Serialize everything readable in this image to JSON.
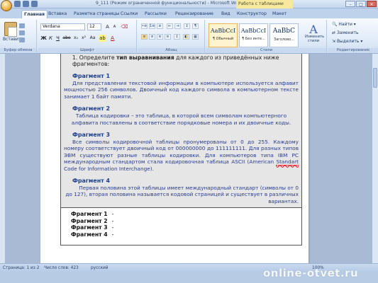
{
  "window": {
    "title": "9_111 (Режим ограниченной функциональности) - Microsoft Word",
    "context_tab": "Работа с таблицами",
    "buttons": [
      "–",
      "□",
      "✕"
    ]
  },
  "tabs": [
    "Главная",
    "Вставка",
    "Разметка страницы",
    "Ссылки",
    "Рассылки",
    "Рецензирование",
    "Вид",
    "Конструктор",
    "Макет"
  ],
  "ribbon": {
    "clipboard": {
      "paste_label": "Вставить",
      "group_label": "Буфер обмена"
    },
    "font": {
      "name": "Verdana",
      "size": "12",
      "group_label": "Шрифт"
    },
    "paragraph": {
      "group_label": "Абзац"
    },
    "styles": {
      "items": [
        {
          "sample": "AaBbCcI",
          "name": "¶ Обычный"
        },
        {
          "sample": "AaBbCcI",
          "name": "¶ Без инте..."
        },
        {
          "sample": "AaBbC",
          "name": "Заголово..."
        }
      ],
      "change_label": "Изменить стили",
      "group_label": "Стили"
    },
    "editing": {
      "find": "Найти",
      "replace": "Заменить",
      "select": "Выделить",
      "group_label": "Редактирование"
    }
  },
  "document": {
    "task_number": "1. Определите",
    "task_bold": "тип выравнивания",
    "task_rest": "для каждого из приведённых ниже фрагментов:",
    "fragments": [
      {
        "title": "Фрагмент 1",
        "text": "Для представления текстовой информации в компьютере используется алфавит мощностью 256 символов. Двоичный код каждого символа в компьютерном тексте занимает 1 байт памяти."
      },
      {
        "title": "Фрагмент 2",
        "text": "Таблица кодировки – это таблица, в которой всем символам компьютерного алфавита поставлены в соответствие порядковые номера и их двоичные коды."
      },
      {
        "title": "Фрагмент 3",
        "text_before": "Все символы кодировочной таблицы пронумерованы от 0 до 255. Каждому номеру соответствует двоичный код от 000000000 до 111111111. Для разных типов ЭВМ существуют разные таблицы кодировки. Для компьютеров типа IBM PC международным стандартом стала кодировочная таблица ASCII (American",
        "text_spell": "Standart",
        "text_after": "Code for Information Interchange)."
      },
      {
        "title": "Фрагмент 4",
        "text": "Первая половина этой таблицы имеет международный стандарт (символы от 0 до 127), вторая половина называется кодовой страницей и существует в различных вариантах."
      }
    ],
    "answers": [
      {
        "label": "Фрагмент 1",
        "value": "-"
      },
      {
        "label": "Фрагмент 2",
        "value": "-"
      },
      {
        "label": "Фрагмент 3",
        "value": "-"
      },
      {
        "label": "Фрагмент 4",
        "value": "-"
      }
    ]
  },
  "status": {
    "page": "Страница: 1 из 2",
    "words": "Число слов: 423",
    "language": "русский",
    "zoom": "100%"
  },
  "watermark": "online-otvet.ru",
  "colors": {
    "fragment_text": "#283d8e",
    "fragment_title": "#1c3f8c",
    "table_fill": "#e6e6e6"
  }
}
